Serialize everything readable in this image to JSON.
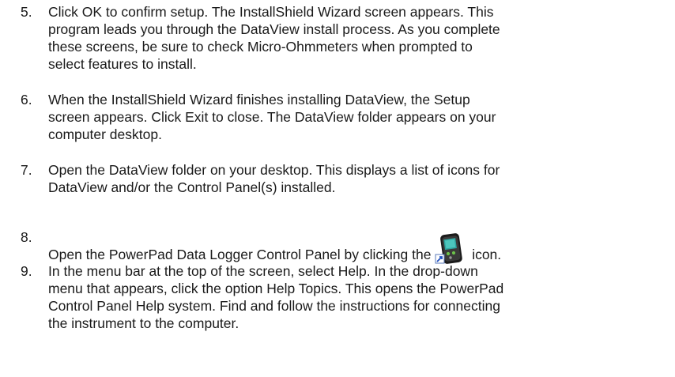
{
  "steps": [
    {
      "number": "5.",
      "text": "Click OK to confirm setup. The InstallShield Wizard screen appears. This\nprogram leads you through the DataView install process. As you complete\nthese screens, be sure to check Micro-Ohmmeters when prompted to\nselect features to install."
    },
    {
      "number": "6.",
      "text": "When the InstallShield Wizard finishes installing DataView, the Setup\nscreen appears. Click Exit to close. The DataView folder appears on your\ncomputer desktop."
    },
    {
      "number": "7.",
      "text": "Open the DataView folder on your desktop. This displays a list of icons for\nDataView and/or the Control Panel(s) installed."
    },
    {
      "number": "8.",
      "text_before_icon": "Open the PowerPad Data Logger Control Panel by clicking the ",
      "icon": "powerpad-control-panel-icon",
      "text_after_icon": " icon."
    },
    {
      "number": "9.",
      "text": "In the menu bar at the top of the screen, select Help. In the drop-down\nmenu that appears, click the option Help Topics. This opens the PowerPad\nControl Panel Help system. Find and follow the instructions for connecting\nthe instrument to the computer."
    }
  ]
}
